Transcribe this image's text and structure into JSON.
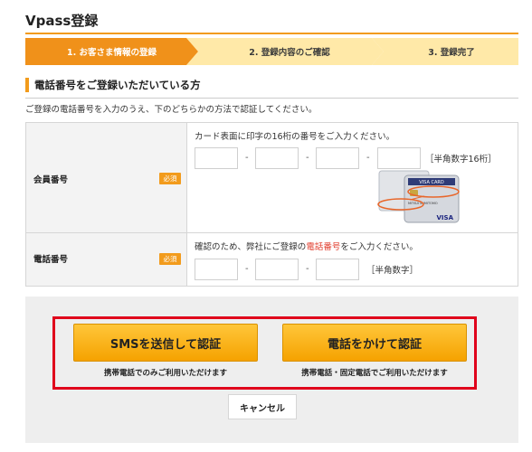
{
  "page": {
    "title": "Vpass登録"
  },
  "steps": [
    {
      "label": "1. お客さま情報の登録",
      "active": true
    },
    {
      "label": "2. 登録内容のご確認",
      "active": false
    },
    {
      "label": "3. 登録完了",
      "active": false
    }
  ],
  "section": {
    "heading": "電話番号をご登録いただいている方",
    "intro": "ご登録の電話番号を入力のうえ、下のどちらかの方法で認証してください。"
  },
  "member_row": {
    "label": "会員番号",
    "required": "必須",
    "hint": "カード表面に印字の16桁の番号をご入力ください。",
    "separator": "-",
    "note": "［半角数字16桁］",
    "inputs": [
      "",
      "",
      "",
      ""
    ],
    "card": {
      "brand_top": "VISA CARD",
      "issuer": "MITSUI SUMITOMO",
      "brand_bottom": "VISA"
    }
  },
  "phone_row": {
    "label": "電話番号",
    "required": "必須",
    "hint_before": "確認のため、弊社にご登録の",
    "hint_highlight": "電話番号",
    "hint_after": "をご入力ください。",
    "separator": "-",
    "note": "［半角数字］",
    "inputs": [
      "",
      "",
      ""
    ]
  },
  "actions": {
    "sms_button": "SMSを送信して認証",
    "sms_note": "携帯電話でのみご利用いただけます",
    "call_button": "電話をかけて認証",
    "call_note": "携帯電話・固定電話でご利用いただけます",
    "cancel_button": "キャンセル"
  },
  "colors": {
    "accent": "#f29b1c",
    "step_inactive": "#ffe9a8",
    "highlight_frame": "#e0001b",
    "button": "#f5a200",
    "emphasis_text": "#e03a2a"
  }
}
